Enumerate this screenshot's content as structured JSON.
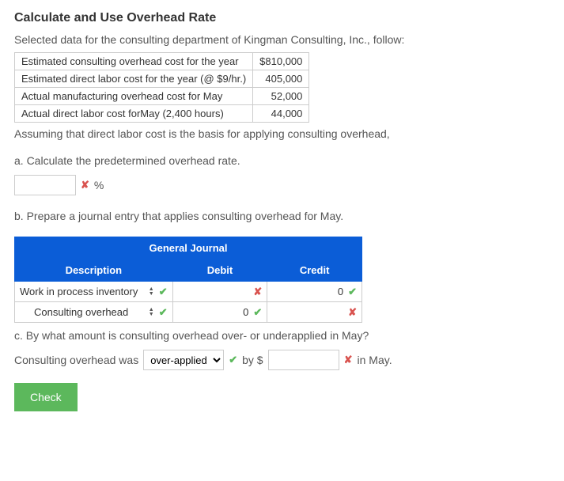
{
  "title": "Calculate and Use Overhead Rate",
  "intro": "Selected data for the consulting department of Kingman Consulting, Inc., follow:",
  "data_table": {
    "rows": [
      {
        "label": "Estimated consulting overhead cost for the year",
        "value": "$810,000"
      },
      {
        "label": "Estimated direct labor cost for the year (@ $9/hr.)",
        "value": "405,000"
      },
      {
        "label": "Actual manufacturing overhead cost for May",
        "value": "52,000"
      },
      {
        "label": "Actual direct labor cost forMay (2,400 hours)",
        "value": "44,000"
      }
    ]
  },
  "assumption": "Assuming that direct labor cost is the basis for applying consulting overhead,",
  "part_a": {
    "prompt": "a. Calculate the predetermined overhead rate.",
    "input_value": "",
    "unit": "%",
    "mark": "✘"
  },
  "part_b": {
    "prompt": "b. Prepare a journal entry that applies consulting overhead for May.",
    "journal": {
      "header_main": "General Journal",
      "col_desc": "Description",
      "col_debit": "Debit",
      "col_credit": "Credit",
      "rows": [
        {
          "desc": "Work in process inventory",
          "desc_mark": "✔",
          "debit": "",
          "debit_mark": "✘",
          "credit": "0",
          "credit_mark": "✔"
        },
        {
          "desc": "Consulting overhead",
          "desc_mark": "✔",
          "debit": "0",
          "debit_mark": "✔",
          "credit": "",
          "credit_mark": "✘"
        }
      ]
    }
  },
  "part_c": {
    "prompt": "c. By what amount is consulting overhead over- or underapplied in May?",
    "lead": "Consulting overhead was",
    "select_value": "over-applied",
    "select_mark": "✔",
    "by_label": "by $",
    "amount_value": "",
    "amount_mark": "✘",
    "tail": "in May."
  },
  "check_label": "Check"
}
